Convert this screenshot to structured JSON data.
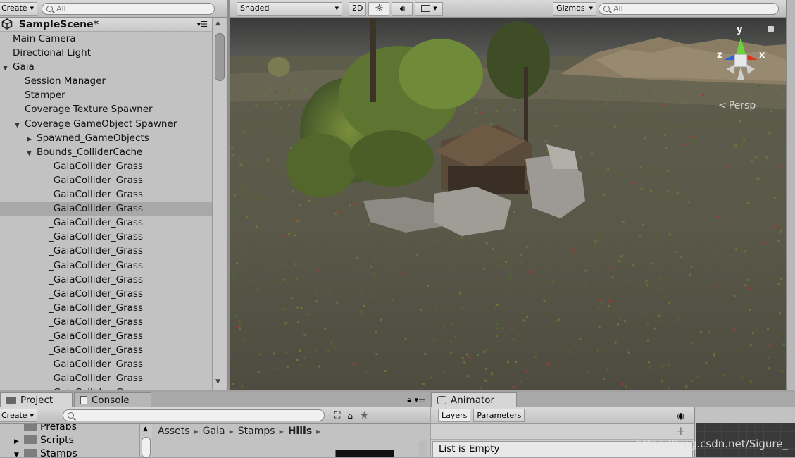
{
  "hierarchy": {
    "create_label": "Create",
    "search_placeholder": "All",
    "scene_name": "SampleScene*",
    "rows": [
      {
        "label": "Main Camera",
        "indent": 0,
        "arrow": "",
        "selected": false
      },
      {
        "label": "Directional Light",
        "indent": 0,
        "arrow": "",
        "selected": false
      },
      {
        "label": "Gaia",
        "indent": 0,
        "arrow": "down",
        "selected": false
      },
      {
        "label": "Session Manager",
        "indent": 1,
        "arrow": "",
        "selected": false
      },
      {
        "label": "Stamper",
        "indent": 1,
        "arrow": "",
        "selected": false
      },
      {
        "label": "Coverage Texture Spawner",
        "indent": 1,
        "arrow": "",
        "selected": false
      },
      {
        "label": "Coverage GameObject Spawner",
        "indent": 1,
        "arrow": "down",
        "selected": false
      },
      {
        "label": "Spawned_GameObjects",
        "indent": 2,
        "arrow": "right",
        "selected": false
      },
      {
        "label": "Bounds_ColliderCache",
        "indent": 2,
        "arrow": "down",
        "selected": false
      },
      {
        "label": "_GaiaCollider_Grass",
        "indent": 3,
        "arrow": "",
        "selected": false
      },
      {
        "label": "_GaiaCollider_Grass",
        "indent": 3,
        "arrow": "",
        "selected": false
      },
      {
        "label": "_GaiaCollider_Grass",
        "indent": 3,
        "arrow": "",
        "selected": false
      },
      {
        "label": "_GaiaCollider_Grass",
        "indent": 3,
        "arrow": "",
        "selected": true
      },
      {
        "label": "_GaiaCollider_Grass",
        "indent": 3,
        "arrow": "",
        "selected": false
      },
      {
        "label": "_GaiaCollider_Grass",
        "indent": 3,
        "arrow": "",
        "selected": false
      },
      {
        "label": "_GaiaCollider_Grass",
        "indent": 3,
        "arrow": "",
        "selected": false
      },
      {
        "label": "_GaiaCollider_Grass",
        "indent": 3,
        "arrow": "",
        "selected": false
      },
      {
        "label": "_GaiaCollider_Grass",
        "indent": 3,
        "arrow": "",
        "selected": false
      },
      {
        "label": "_GaiaCollider_Grass",
        "indent": 3,
        "arrow": "",
        "selected": false
      },
      {
        "label": "_GaiaCollider_Grass",
        "indent": 3,
        "arrow": "",
        "selected": false
      },
      {
        "label": "_GaiaCollider_Grass",
        "indent": 3,
        "arrow": "",
        "selected": false
      },
      {
        "label": "_GaiaCollider_Grass",
        "indent": 3,
        "arrow": "",
        "selected": false
      },
      {
        "label": "_GaiaCollider_Grass",
        "indent": 3,
        "arrow": "",
        "selected": false
      },
      {
        "label": "_GaiaCollider_Grass",
        "indent": 3,
        "arrow": "",
        "selected": false
      },
      {
        "label": "_GaiaCollider_Grass",
        "indent": 3,
        "arrow": "",
        "selected": false
      },
      {
        "label": "_GaiaCollider_Grass",
        "indent": 3,
        "arrow": "",
        "selected": false
      }
    ]
  },
  "scene_toolbar": {
    "shading_mode": "Shaded",
    "mode_2d": "2D",
    "gizmos_label": "Gizmos",
    "search_placeholder": "All"
  },
  "scene_view": {
    "projection_label": "Persp",
    "axis_y": "y",
    "axis_x": "x",
    "axis_z": "z"
  },
  "project_panel": {
    "tab_project": "Project",
    "tab_console": "Console",
    "create_label": "Create",
    "folders": [
      {
        "label": "Prefabs",
        "arrow": ""
      },
      {
        "label": "Scripts",
        "arrow": "right"
      },
      {
        "label": "Stamps",
        "arrow": "down"
      }
    ],
    "breadcrumb": [
      "Assets",
      "Gaia",
      "Stamps",
      "Hills"
    ]
  },
  "animator_panel": {
    "tab_label": "Animator",
    "subtab_layers": "Layers",
    "subtab_parameters": "Parameters",
    "empty_text": "List is Empty",
    "watermark": "https://blog.csdn.net/Sigure_"
  }
}
